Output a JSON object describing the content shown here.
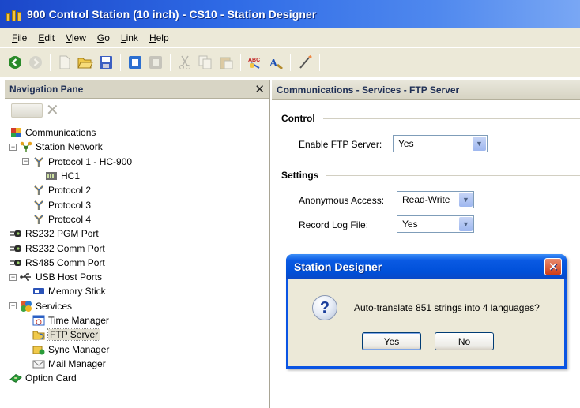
{
  "window": {
    "title": "900 Control Station (10 inch) - CS10 - Station Designer"
  },
  "menu": [
    {
      "label": "File",
      "accel": "F",
      "rest": "ile"
    },
    {
      "label": "Edit",
      "accel": "E",
      "rest": "dit"
    },
    {
      "label": "View",
      "accel": "V",
      "rest": "iew"
    },
    {
      "label": "Go",
      "accel": "G",
      "rest": "o"
    },
    {
      "label": "Link",
      "accel": "L",
      "rest": "ink"
    },
    {
      "label": "Help",
      "accel": "H",
      "rest": "elp"
    }
  ],
  "nav": {
    "header": "Navigation Pane",
    "close_glyph": "✕",
    "tree": [
      {
        "label": "Communications",
        "icon": "communications-icon",
        "level": 0,
        "expander": ""
      },
      {
        "label": "Station Network",
        "icon": "network-icon",
        "level": 0,
        "expander": "−"
      },
      {
        "label": "Protocol 1 - HC-900",
        "icon": "protocol-icon",
        "level": 1,
        "expander": "−"
      },
      {
        "label": "HC1",
        "icon": "controller-icon",
        "level": 2,
        "expander": ""
      },
      {
        "label": "Protocol 2",
        "icon": "protocol-icon",
        "level": 1,
        "expander": ""
      },
      {
        "label": "Protocol 3",
        "icon": "protocol-icon",
        "level": 1,
        "expander": ""
      },
      {
        "label": "Protocol 4",
        "icon": "protocol-icon",
        "level": 1,
        "expander": ""
      },
      {
        "label": "RS232 PGM Port",
        "icon": "port-icon",
        "level": 0,
        "expander": ""
      },
      {
        "label": "RS232 Comm Port",
        "icon": "port-icon",
        "level": 0,
        "expander": ""
      },
      {
        "label": "RS485 Comm Port",
        "icon": "port-icon",
        "level": 0,
        "expander": ""
      },
      {
        "label": "USB Host Ports",
        "icon": "usb-icon",
        "level": 0,
        "expander": "−"
      },
      {
        "label": "Memory Stick",
        "icon": "memory-stick-icon",
        "level": 1,
        "expander": ""
      },
      {
        "label": "Services",
        "icon": "services-icon",
        "level": 0,
        "expander": "−"
      },
      {
        "label": "Time Manager",
        "icon": "time-manager-icon",
        "level": 1,
        "expander": ""
      },
      {
        "label": "FTP Server",
        "icon": "ftp-server-icon",
        "level": 1,
        "expander": "",
        "selected": true
      },
      {
        "label": "Sync Manager",
        "icon": "sync-manager-icon",
        "level": 1,
        "expander": ""
      },
      {
        "label": "Mail Manager",
        "icon": "mail-manager-icon",
        "level": 1,
        "expander": ""
      },
      {
        "label": "Option Card",
        "icon": "option-card-icon",
        "level": 0,
        "expander": ""
      }
    ]
  },
  "right": {
    "header": "Communications - Services - FTP Server",
    "control_title": "Control",
    "enable_ftp_label": "Enable FTP Server:",
    "enable_ftp_value": "Yes",
    "settings_title": "Settings",
    "anonymous_label": "Anonymous Access:",
    "anonymous_value": "Read-Write",
    "record_log_label": "Record Log File:",
    "record_log_value": "Yes"
  },
  "dialog": {
    "title": "Station Designer",
    "close_glyph": "✕",
    "question_glyph": "?",
    "message": "Auto-translate 851 strings into 4 languages?",
    "yes_label": "Yes",
    "no_label": "No"
  },
  "colors": {
    "titlebar": "#2f6be6",
    "chrome": "#ece9d8",
    "dialog_border": "#0a54e3"
  }
}
